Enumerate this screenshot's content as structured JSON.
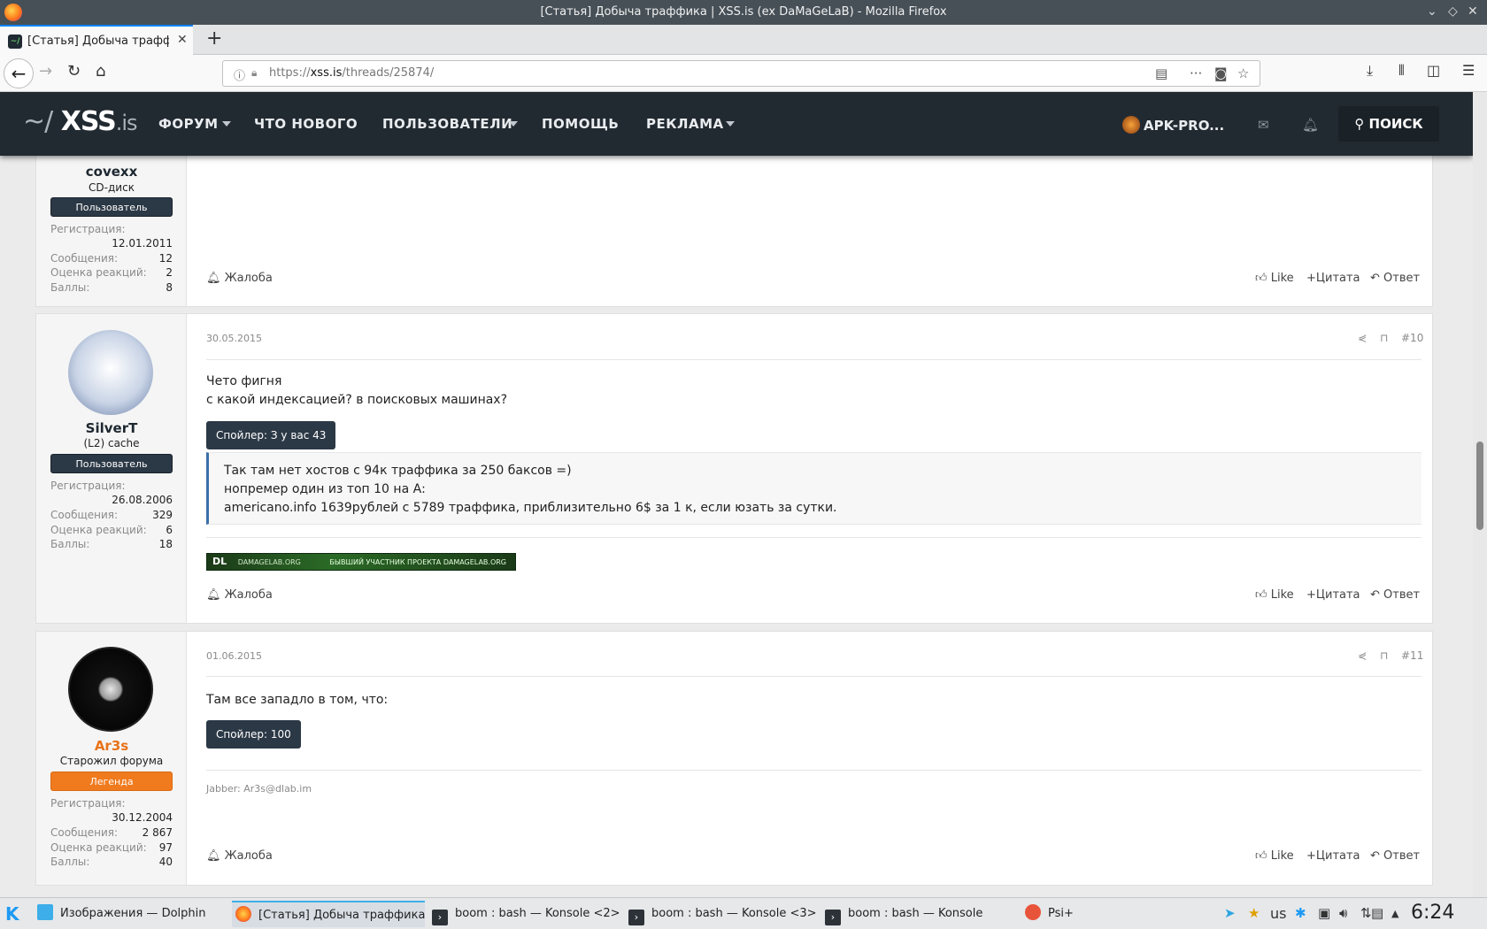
{
  "window": {
    "title": "[Статья] Добыча траффика | XSS.is (ex DaMaGeLaB) - Mozilla Firefox"
  },
  "tab": {
    "label": "[Статья] Добыча траффика | XSS.is (ex DaMaGeLaB)",
    "favicon": "xss-favicon"
  },
  "url": {
    "prefix": "https://",
    "host": "xss.is",
    "path": "/threads/25874/"
  },
  "site": {
    "logo_tilde": "~/",
    "logo_main": "XSS",
    "logo_suffix": ".is",
    "nav": [
      "ФОРУМ",
      "ЧТО НОВОГО",
      "ПОЛЬЗОВАТЕЛИ",
      "ПОМОЩЬ",
      "РЕКЛАМА"
    ],
    "user": "APK-PRO...",
    "search": "ПОИСК"
  },
  "labels": {
    "reg": "Регистрация:",
    "msgs": "Сообщения:",
    "react": "Оценка реакций:",
    "points": "Баллы:",
    "report": "Жалоба",
    "like": "Like",
    "quote": "Цитата",
    "reply": "Ответ"
  },
  "posts": [
    {
      "user": "covexx",
      "title": "CD-диск",
      "badge": "Пользователь",
      "reg": "12.01.2011",
      "msgs": "12",
      "react": "2",
      "points": "8"
    },
    {
      "user": "SilverT",
      "title": "(L2) cache",
      "badge": "Пользователь",
      "reg": "26.08.2006",
      "msgs": "329",
      "react": "6",
      "points": "18",
      "date": "30.05.2015",
      "num": "#10",
      "text1": "Чето фигня",
      "text2": "с какой индексацией? в поисковых машинах?",
      "spoiler": "Спойлер: З у вас 43",
      "quote": [
        "Так там нет хостов с 94к траффика за 250 баксов =)",
        "нопремер один из топ 10 на А:",
        "americano.info 1639рублей с 5789 траффика, приблизительно 6$ за 1 к, если юзать за сутки."
      ],
      "banner_left": "DAMAGELAB.ORG",
      "banner_right": "БЫВШИЙ УЧАСТНИК ПРОЕКТА DAMAGELAB.ORG"
    },
    {
      "user": "Ar3s",
      "title": "Старожил форума",
      "badge": "Легенда",
      "reg": "30.12.2004",
      "msgs": "2 867",
      "react": "97",
      "points": "40",
      "date": "01.06.2015",
      "num": "#11",
      "text1": "Там все западло в том, что:",
      "spoiler": "Спойлер: 100",
      "signature": "Jabber: Ar3s@dlab.im"
    }
  ],
  "taskbar": {
    "items": [
      "Изображения — Dolphin",
      "[Статья] Добыча траффика ...",
      "boom : bash — Konsole <2>",
      "boom : bash — Konsole <3>",
      "boom : bash — Konsole",
      "Psi+"
    ],
    "layout": "us",
    "clock": "6:24"
  },
  "colors": {
    "accent_orange": "#f07a1e",
    "header_bg": "#222a31",
    "badge_dark": "#2b3845"
  }
}
